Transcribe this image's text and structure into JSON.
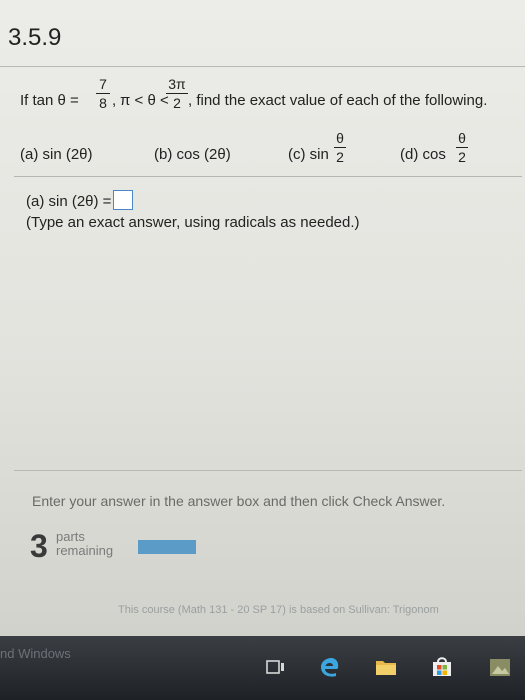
{
  "header": {
    "section": "3.5.9"
  },
  "problem": {
    "prefix": "If tan θ =",
    "frac1_num": "7",
    "frac1_den": "8",
    "sep": ",",
    "pi_cond": "π < θ <",
    "frac2_num": "3π",
    "frac2_den": "2",
    "suffix": ", find the exact value of each of the following."
  },
  "parts": {
    "a_label": "(a) sin (2θ)",
    "b_label": "(b) cos (2θ)",
    "c_prefix": "(c) sin",
    "c_num": "θ",
    "c_den": "2",
    "d_prefix": "(d) cos",
    "d_num": "θ",
    "d_den": "2"
  },
  "answer": {
    "label": "(a) sin (2θ) =",
    "value": "",
    "hint": "(Type an exact answer, using radicals as needed.)"
  },
  "instructions": "Enter your answer in the answer box and then click Check Answer.",
  "remaining": {
    "count": "3",
    "word1": "parts",
    "word2": "remaining",
    "progress": 0.0
  },
  "footer": {
    "note": "This course (Math 131 - 20 SP 17) is based on Sullivan: Trigonom"
  },
  "taskbar": {
    "text": "nd Windows",
    "icons": [
      "task-view-icon",
      "edge-browser-icon",
      "file-explorer-icon",
      "store-icon",
      "app-icon"
    ]
  },
  "colors": {
    "accent": "#4a87c8",
    "progress": "#5a9bc8",
    "taskbar": "#24282d"
  }
}
